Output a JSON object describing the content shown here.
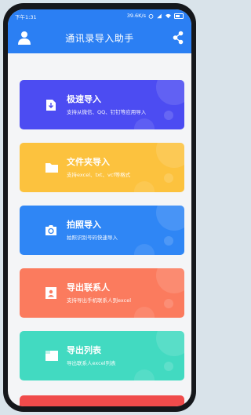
{
  "status": {
    "time": "下午1:31",
    "speed": "39.6K/s",
    "battery": "88"
  },
  "header": {
    "title": "通讯录导入助手"
  },
  "cards": [
    {
      "title": "极速导入",
      "subtitle": "支持从微信、QQ、钉钉等应用导入",
      "color": "#4c4cf2",
      "icon": "download-file-icon"
    },
    {
      "title": "文件夹导入",
      "subtitle": "支持excel、txt、vcf等格式",
      "color": "#fcc23e",
      "icon": "folder-icon"
    },
    {
      "title": "拍照导入",
      "subtitle": "拍照识别号码快速导入",
      "color": "#2f86f5",
      "icon": "camera-icon"
    },
    {
      "title": "导出联系人",
      "subtitle": "支持导出手机联系人到excel",
      "color": "#fb7b5e",
      "icon": "contact-card-icon"
    },
    {
      "title": "导出列表",
      "subtitle": "导出联系人excel列表",
      "color": "#42dac1",
      "icon": "list-file-icon"
    }
  ],
  "colors": {
    "primary": "#2b7ff3",
    "partial_card": "#f04b4b"
  }
}
